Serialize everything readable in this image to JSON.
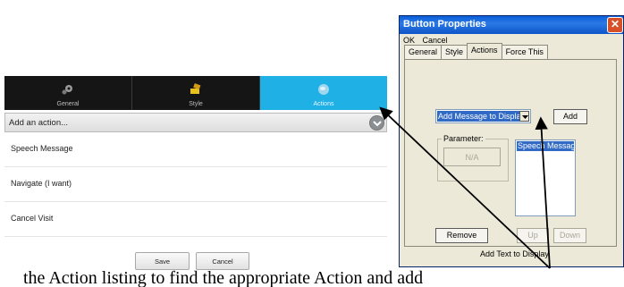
{
  "mobile": {
    "tabs": [
      {
        "label": "General",
        "icon": "gears-icon"
      },
      {
        "label": "Style",
        "icon": "paint-brush-icon"
      },
      {
        "label": "Actions",
        "icon": "globe-icon"
      }
    ],
    "add_action_label": "Add an action...",
    "actions": [
      "Speech Message",
      "Navigate (I want)",
      "Cancel Visit"
    ],
    "save_label": "Save",
    "cancel_label": "Cancel",
    "active_tab_color": "#1fb0e6"
  },
  "caption_text": "the Action listing to find the appropriate Action and add",
  "dialog": {
    "title": "Button Properties",
    "close_glyph": "✕",
    "menu": [
      "OK",
      "Cancel"
    ],
    "tabs": [
      "General",
      "Style",
      "Actions",
      "Force This"
    ],
    "selected_tab": "Actions",
    "combo_value": "Add Message to Display",
    "add_label": "Add",
    "parameter_label": "Parameter:",
    "parameter_value": "N/A",
    "list_items": [
      "Speech Message"
    ],
    "remove_label": "Remove",
    "up_label": "Up",
    "down_label": "Down",
    "footer_text": "Add Text to Display",
    "title_color": "#0a5fd8"
  }
}
